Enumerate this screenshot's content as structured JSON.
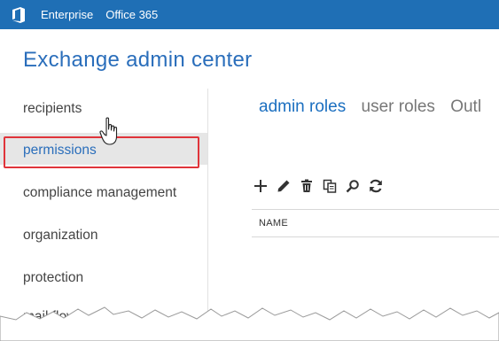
{
  "topbar": {
    "links": [
      "Enterprise",
      "Office 365"
    ],
    "bg_color": "#1f6fb5",
    "logo_icon": "office-logo-icon"
  },
  "app": {
    "title": "Exchange admin center",
    "title_color": "#2a6ebb"
  },
  "nav": {
    "items": [
      {
        "label": "recipients",
        "selected": false
      },
      {
        "label": "permissions",
        "selected": true
      },
      {
        "label": "compliance management",
        "selected": false
      },
      {
        "label": "organization",
        "selected": false
      },
      {
        "label": "protection",
        "selected": false
      },
      {
        "label": "mail flow",
        "selected": false
      }
    ],
    "highlight_color": "#e0343a"
  },
  "tabs": [
    {
      "label": "admin roles",
      "active": true
    },
    {
      "label": "user roles",
      "active": false
    },
    {
      "label": "Outl",
      "active": false
    }
  ],
  "toolbar": {
    "icons": [
      "add-icon",
      "edit-icon",
      "delete-icon",
      "copy-icon",
      "search-icon",
      "refresh-icon"
    ]
  },
  "table": {
    "columns": [
      "NAME"
    ]
  }
}
